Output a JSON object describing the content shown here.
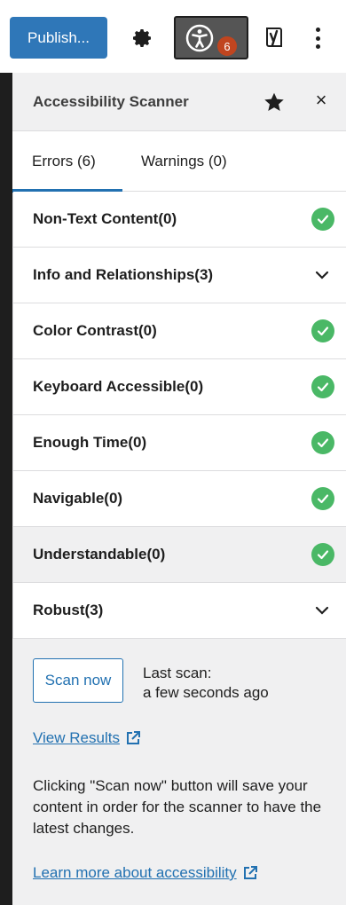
{
  "toolbar": {
    "publish_label": "Publish...",
    "settings_icon": "gear-icon",
    "accessibility_icon": "accessibility-icon",
    "accessibility_badge": "6",
    "yoast_icon": "yoast-icon",
    "more_icon": "vertical-ellipsis-icon"
  },
  "panel": {
    "title": "Accessibility Scanner",
    "pin_icon": "star-icon",
    "close_icon": "close-icon",
    "close_glyph": "×"
  },
  "tabs": [
    {
      "label": "Errors (6)",
      "active": true
    },
    {
      "label": "Warnings (0)",
      "active": false
    }
  ],
  "items": [
    {
      "label": "Non-Text Content(0)",
      "status": "pass"
    },
    {
      "label": "Info and Relationships(3)",
      "status": "expand"
    },
    {
      "label": "Color Contrast(0)",
      "status": "pass"
    },
    {
      "label": "Keyboard Accessible(0)",
      "status": "pass"
    },
    {
      "label": "Enough Time(0)",
      "status": "pass"
    },
    {
      "label": "Navigable(0)",
      "status": "pass"
    },
    {
      "label": "Understandable(0)",
      "status": "pass"
    },
    {
      "label": "Robust(3)",
      "status": "expand"
    }
  ],
  "scan": {
    "button_label": "Scan now",
    "last_scan_label": "Last scan:",
    "last_scan_value": "a few seconds ago",
    "view_results": "View Results",
    "note": "Clicking \"Scan now\" button will save your content in order for the scanner to have the latest changes.",
    "learn_more": "Learn more about accessibility"
  },
  "colors": {
    "primary": "#2271b1",
    "publish_bg": "#2f77b8",
    "pass": "#4ab866",
    "badge": "#c0451f"
  }
}
